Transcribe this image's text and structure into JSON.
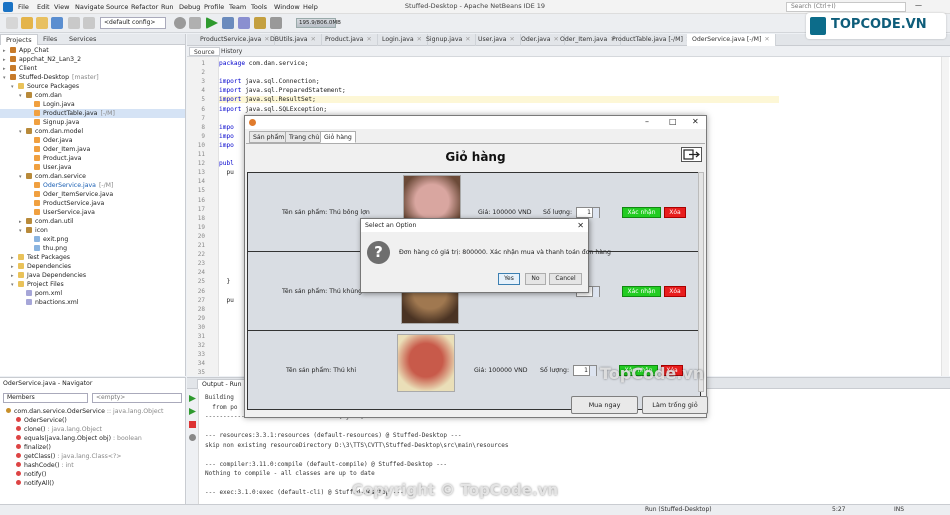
{
  "window": {
    "title": "Stuffed-Desktop - Apache NetBeans IDE 19"
  },
  "menu": [
    "File",
    "Edit",
    "View",
    "Navigate",
    "Source",
    "Refactor",
    "Run",
    "Debug",
    "Profile",
    "Team",
    "Tools",
    "Window",
    "Help"
  ],
  "search": {
    "placeholder": "Search (Ctrl+I)"
  },
  "toolbar": {
    "config": "<default config>",
    "memory": "195.9/806.0MB"
  },
  "projects_panel": {
    "tabs": [
      "Projects",
      "Files",
      "Services"
    ],
    "tree": [
      {
        "label": "App_Chat",
        "tag": "",
        "level": 0,
        "icon": "proj",
        "toggle": "+"
      },
      {
        "label": "appchat_N2_Lan3_2",
        "tag": "",
        "level": 0,
        "icon": "proj",
        "toggle": "+"
      },
      {
        "label": "Client",
        "tag": "",
        "level": 0,
        "icon": "proj",
        "toggle": "+"
      },
      {
        "label": "Stuffed-Desktop",
        "tag": "[master]",
        "level": 0,
        "icon": "proj",
        "toggle": "-"
      },
      {
        "label": "Source Packages",
        "tag": "",
        "level": 1,
        "icon": "folder",
        "toggle": "-"
      },
      {
        "label": "com.dan",
        "tag": "",
        "level": 2,
        "icon": "pkg",
        "toggle": "-"
      },
      {
        "label": "Login.java",
        "tag": "",
        "level": 3,
        "icon": "java",
        "toggle": ""
      },
      {
        "label": "ProductTable.java",
        "tag": "[-/M]",
        "level": 3,
        "icon": "java",
        "toggle": "",
        "selected": true
      },
      {
        "label": "Signup.java",
        "tag": "",
        "level": 3,
        "icon": "java",
        "toggle": ""
      },
      {
        "label": "com.dan.model",
        "tag": "",
        "level": 2,
        "icon": "pkg",
        "toggle": "-"
      },
      {
        "label": "Oder.java",
        "tag": "",
        "level": 3,
        "icon": "java",
        "toggle": ""
      },
      {
        "label": "Oder_Item.java",
        "tag": "",
        "level": 3,
        "icon": "java",
        "toggle": ""
      },
      {
        "label": "Product.java",
        "tag": "",
        "level": 3,
        "icon": "java",
        "toggle": ""
      },
      {
        "label": "User.java",
        "tag": "",
        "level": 3,
        "icon": "java",
        "toggle": ""
      },
      {
        "label": "com.dan.service",
        "tag": "",
        "level": 2,
        "icon": "pkg",
        "toggle": "-"
      },
      {
        "label": "OderService.java",
        "tag": "[-/M]",
        "level": 3,
        "icon": "java",
        "toggle": "",
        "highlight": true
      },
      {
        "label": "Oder_ItemService.java",
        "tag": "",
        "level": 3,
        "icon": "java",
        "toggle": ""
      },
      {
        "label": "ProductService.java",
        "tag": "",
        "level": 3,
        "icon": "java",
        "toggle": ""
      },
      {
        "label": "UserService.java",
        "tag": "",
        "level": 3,
        "icon": "java",
        "toggle": ""
      },
      {
        "label": "com.dan.util",
        "tag": "",
        "level": 2,
        "icon": "pkg",
        "toggle": "+"
      },
      {
        "label": "icon",
        "tag": "",
        "level": 2,
        "icon": "pkg",
        "toggle": "-"
      },
      {
        "label": "exit.png",
        "tag": "",
        "level": 3,
        "icon": "png",
        "toggle": ""
      },
      {
        "label": "thu.png",
        "tag": "",
        "level": 3,
        "icon": "png",
        "toggle": ""
      },
      {
        "label": "Test Packages",
        "tag": "",
        "level": 1,
        "icon": "folder",
        "toggle": "+"
      },
      {
        "label": "Dependencies",
        "tag": "",
        "level": 1,
        "icon": "folder",
        "toggle": "+"
      },
      {
        "label": "Java Dependencies",
        "tag": "",
        "level": 1,
        "icon": "folder",
        "toggle": "+"
      },
      {
        "label": "Project Files",
        "tag": "",
        "level": 1,
        "icon": "folder",
        "toggle": "-"
      },
      {
        "label": "pom.xml",
        "tag": "",
        "level": 2,
        "icon": "xml",
        "toggle": ""
      },
      {
        "label": "nbactions.xml",
        "tag": "",
        "level": 2,
        "icon": "xml",
        "toggle": ""
      }
    ]
  },
  "navigator": {
    "title": "OderService.java - Navigator",
    "members_label": "Members",
    "filter": "<empty>",
    "items": [
      {
        "label": "com.dan.service.OderService",
        "detail": " :: java.lang.Object",
        "color": "#c8902a"
      },
      {
        "label": "OderService()",
        "detail": "",
        "color": "#d44"
      },
      {
        "label": "clone()",
        "detail": " : java.lang.Object",
        "color": "#d44"
      },
      {
        "label": "equals(java.lang.Object obj)",
        "detail": " : boolean",
        "color": "#d44"
      },
      {
        "label": "finalize()",
        "detail": "",
        "color": "#d44"
      },
      {
        "label": "getClass()",
        "detail": " : java.lang.Class<?>",
        "color": "#d44"
      },
      {
        "label": "hashCode()",
        "detail": " : int",
        "color": "#d44"
      },
      {
        "label": "notify()",
        "detail": "",
        "color": "#d44"
      },
      {
        "label": "notifyAll()",
        "detail": "",
        "color": "#d44"
      }
    ]
  },
  "editor": {
    "tabs": [
      {
        "label": "ProductService.java",
        "active": false
      },
      {
        "label": "DBUtils.java",
        "active": false
      },
      {
        "label": "Product.java",
        "active": false
      },
      {
        "label": "Login.java",
        "active": false
      },
      {
        "label": "Signup.java",
        "active": false
      },
      {
        "label": "User.java",
        "active": false
      },
      {
        "label": "Oder.java",
        "active": false
      },
      {
        "label": "Oder_Item.java",
        "active": false
      },
      {
        "label": "ProductTable.java [-/M]",
        "active": false
      },
      {
        "label": "OderService.java [-/M]",
        "active": true
      }
    ],
    "source_label": "Source",
    "history_label": "History",
    "lines": [
      {
        "n": "1",
        "kw": "package",
        "rest": " com.dan.service;"
      },
      {
        "n": "2",
        "kw": "",
        "rest": ""
      },
      {
        "n": "3",
        "kw": "import",
        "rest": " java.sql.Connection;"
      },
      {
        "n": "4",
        "kw": "import",
        "rest": " java.sql.PreparedStatement;"
      },
      {
        "n": "5",
        "kw": "import",
        "rest": " java.sql.ResultSet;"
      },
      {
        "n": "6",
        "kw": "import",
        "rest": " java.sql.SQLException;"
      },
      {
        "n": "7",
        "kw": "",
        "rest": ""
      },
      {
        "n": "8",
        "kw": "impo",
        "rest": ""
      },
      {
        "n": "9",
        "kw": "impo",
        "rest": ""
      },
      {
        "n": "10",
        "kw": "impo",
        "rest": ""
      },
      {
        "n": "11",
        "kw": "",
        "rest": ""
      },
      {
        "n": "12",
        "kw": "publ",
        "rest": ""
      },
      {
        "n": "13",
        "kw": "",
        "rest": "  pu"
      },
      {
        "n": "14",
        "kw": "",
        "rest": ""
      },
      {
        "n": "15",
        "kw": "",
        "rest": ""
      },
      {
        "n": "16",
        "kw": "",
        "rest": ""
      },
      {
        "n": "17",
        "kw": "",
        "rest": ""
      },
      {
        "n": "18",
        "kw": "",
        "rest": ""
      },
      {
        "n": "19",
        "kw": "",
        "rest": ""
      },
      {
        "n": "20",
        "kw": "",
        "rest": ""
      },
      {
        "n": "21",
        "kw": "",
        "rest": ""
      },
      {
        "n": "22",
        "kw": "",
        "rest": ""
      },
      {
        "n": "23",
        "kw": "",
        "rest": ""
      },
      {
        "n": "24",
        "kw": "",
        "rest": ""
      },
      {
        "n": "25",
        "kw": "",
        "rest": "  }"
      },
      {
        "n": "26",
        "kw": "",
        "rest": ""
      },
      {
        "n": "27",
        "kw": "",
        "rest": "  pu"
      },
      {
        "n": "28",
        "kw": "",
        "rest": ""
      },
      {
        "n": "29",
        "kw": "",
        "rest": ""
      },
      {
        "n": "30",
        "kw": "",
        "rest": ""
      },
      {
        "n": "31",
        "kw": "",
        "rest": ""
      },
      {
        "n": "32",
        "kw": "",
        "rest": ""
      },
      {
        "n": "33",
        "kw": "",
        "rest": ""
      },
      {
        "n": "34",
        "kw": "",
        "rest": ""
      },
      {
        "n": "35",
        "kw": "",
        "rest": ""
      }
    ]
  },
  "app": {
    "tabs": [
      {
        "label": "Sản phẩm",
        "active": false
      },
      {
        "label": "Trang chủ",
        "active": false
      },
      {
        "label": "Giỏ hàng",
        "active": true
      }
    ],
    "heading": "Giỏ hàng",
    "items": [
      {
        "name": "Tên sản phẩm: Thú bông lợn",
        "price": "Giá: 100000 VND",
        "qty_label": "Số lượng:",
        "qty": "1",
        "confirm": "Xác nhận",
        "delete": "Xóa",
        "colors": [
          "#d9a6a0",
          "#6b4a38"
        ]
      },
      {
        "name": "Tên sản phẩm: Thú khủng lồ",
        "price": "",
        "qty_label": "",
        "qty": "",
        "confirm": "Xác nhận",
        "delete": "Xóa",
        "colors": [
          "#a07850",
          "#4a3323"
        ]
      },
      {
        "name": "Tên sản phẩm: Thú khỉ",
        "price": "Giá: 100000 VND",
        "qty_label": "Số lượng:",
        "qty": "1",
        "confirm": "Xác nhận",
        "delete": "Xóa",
        "colors": [
          "#c85a4a",
          "#eadfb8"
        ]
      }
    ],
    "buy_now": "Mua ngay",
    "clear_cart": "Làm trống giỏ"
  },
  "dialog": {
    "title": "Select an Option",
    "message": "Đơn hàng có giá trị: 800000. Xác nhận mua và thanh toán đơn hàng",
    "yes": "Yes",
    "no": "No",
    "cancel": "Cancel"
  },
  "output": {
    "title": "Output - Run (Stuffed-Desktop)",
    "lines": [
      "Building",
      "  from po",
      "-------------------------------------[ jar ]---------------------------------",
      "",
      "--- resources:3.3.1:resources (default-resources) @ Stuffed-Desktop ---",
      "skip non existing resourceDirectory D:\\3\\TTS\\CVTT\\Stuffed-Desktop\\src\\main\\resources",
      "",
      "--- compiler:3.11.0:compile (default-compile) @ Stuffed-Desktop ---",
      "Nothing to compile - all classes are up to date",
      "",
      "--- exec:3.1.0:exec (default-cli) @ Stuffed-Desktop ---"
    ]
  },
  "status": {
    "run": "Run (Stuffed-Desktop)",
    "pos": "5:27",
    "mode": "INS"
  },
  "watermarks": {
    "logo": "TOPCODE.VN",
    "center": "TopCode.vn",
    "bottom": "Copyright © TopCode.vn"
  }
}
